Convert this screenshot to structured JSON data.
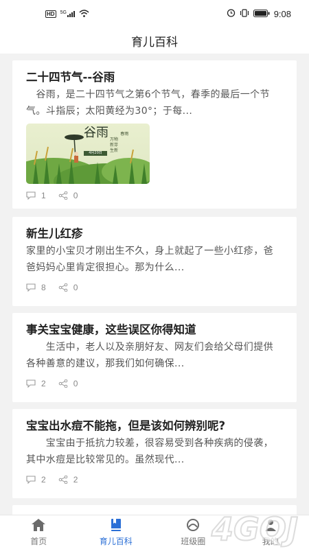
{
  "status": {
    "hd": "HD",
    "signal": "5G",
    "time": "9:08"
  },
  "header": {
    "title": "育儿百科"
  },
  "articles": [
    {
      "title": "二十四节气--谷雨",
      "excerpt": "　谷雨，是二十四节气之第6个节气，春季的最后一个节气。斗指辰；太阳黄经为30°；于每...",
      "thumb": {
        "big_char": "谷雨",
        "side_text": "春雨\n万物\n新芽\n生新",
        "date": "4月20日"
      },
      "comments": "1",
      "shares": "0"
    },
    {
      "title": "新生儿红疹",
      "excerpt": "家里的小宝贝才刚出生不久，身上就起了一些小红疹，爸爸妈妈心里肯定很担心。那为什么...",
      "comments": "8",
      "shares": "0"
    },
    {
      "title": "事关宝宝健康，这些误区你得知道",
      "excerpt": "　　生活中，老人以及亲朋好友、网友们会给父母们提供各种善意的建议，那我们如何确保...",
      "comments": "2",
      "shares": "0"
    },
    {
      "title": "宝宝出水痘不能拖，但是该如何辨别呢?",
      "excerpt": "　　宝宝由于抵抗力较差，很容易受到各种疾病的侵袭，其中水痘是比较常见的。虽然现代...",
      "comments": "2",
      "shares": "2"
    }
  ],
  "nav": {
    "items": [
      {
        "label": "首页",
        "icon": "home-icon"
      },
      {
        "label": "育儿百科",
        "icon": "bookmark-book-icon",
        "active": true
      },
      {
        "label": "班级圈",
        "icon": "circle-icon"
      },
      {
        "label": "我的",
        "icon": "person-icon"
      }
    ]
  },
  "watermark": {
    "text": "4GQJ"
  },
  "colors": {
    "accent": "#2b6fd6",
    "background": "#f2f2f2",
    "card": "#ffffff",
    "meta": "#888888"
  }
}
